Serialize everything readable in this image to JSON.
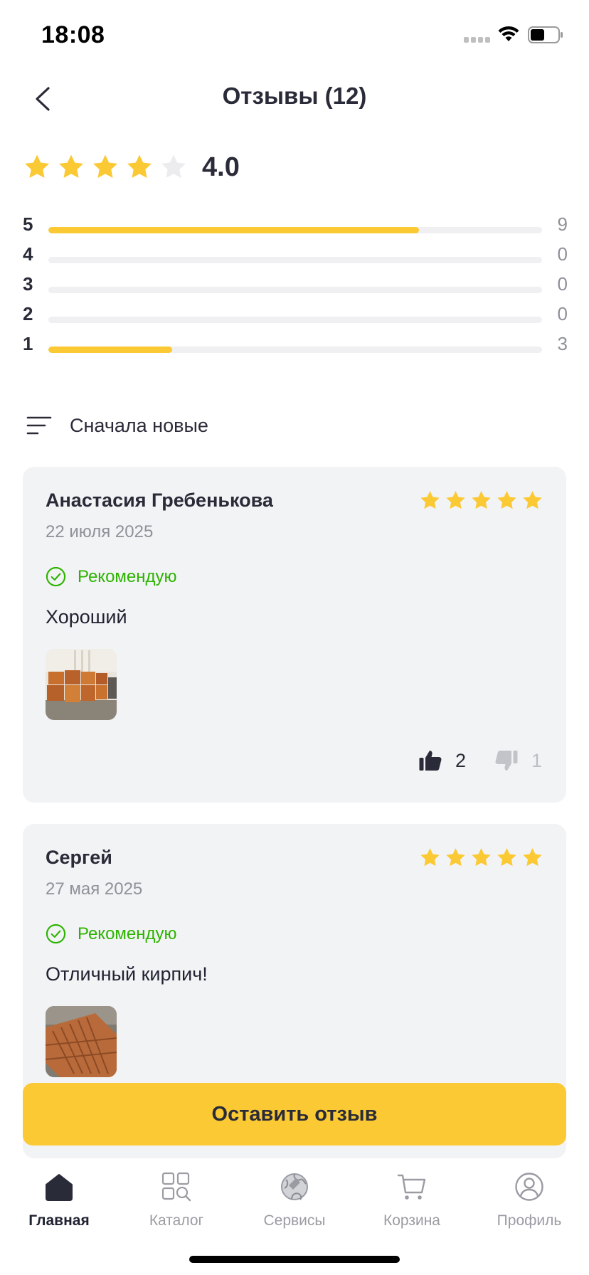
{
  "status_bar": {
    "time": "18:08",
    "icons": [
      "cellular-signal-icon",
      "wifi-icon",
      "battery-icon"
    ]
  },
  "header": {
    "title": "Отзывы (12)",
    "back_icon": "chevron-left-icon"
  },
  "summary": {
    "rating": "4.0",
    "stars_filled": 4,
    "stars_total": 5,
    "distribution": [
      {
        "stars": "5",
        "count": "9",
        "fraction": 0.75
      },
      {
        "stars": "4",
        "count": "0",
        "fraction": 0
      },
      {
        "stars": "3",
        "count": "0",
        "fraction": 0
      },
      {
        "stars": "2",
        "count": "0",
        "fraction": 0
      },
      {
        "stars": "1",
        "count": "3",
        "fraction": 0.25
      }
    ]
  },
  "sort": {
    "label": "Сначала новые",
    "icon": "sort-lines-icon"
  },
  "reviews": [
    {
      "author": "Анастасия Гребенькова",
      "date": "22 июля 2025",
      "stars": 5,
      "recommend_label": "Рекомендую",
      "text": "Хороший",
      "likes": "2",
      "dislikes": "1"
    },
    {
      "author": "Сергей",
      "date": "27 мая 2025",
      "stars": 5,
      "recommend_label": "Рекомендую",
      "text": "Отличный кирпич!"
    }
  ],
  "leave_review_label": "Оставить отзыв",
  "tab_bar": {
    "tabs": [
      {
        "label": "Главная",
        "icon": "home-icon",
        "active": true
      },
      {
        "label": "Каталог",
        "icon": "catalog-search-icon",
        "active": false
      },
      {
        "label": "Сервисы",
        "icon": "services-globe-icon",
        "active": false
      },
      {
        "label": "Корзина",
        "icon": "cart-icon",
        "active": false
      },
      {
        "label": "Профиль",
        "icon": "profile-icon",
        "active": false
      }
    ]
  },
  "colors": {
    "accent": "#fbc933",
    "star_empty": "#ececee",
    "recommend_green": "#2db300",
    "card_bg": "#f2f3f5",
    "text_dark": "#2a2b38",
    "text_muted": "#8f9199"
  }
}
